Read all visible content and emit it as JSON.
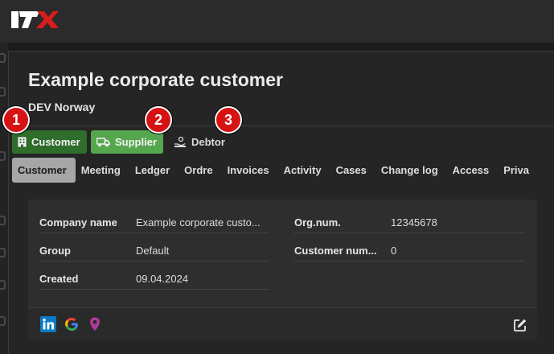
{
  "app": {
    "logo_text": "ITX"
  },
  "page": {
    "title": "Example corporate customer",
    "subtitle": "DEV Norway"
  },
  "roles": [
    {
      "label": "Customer",
      "icon": "building-icon"
    },
    {
      "label": "Supplier",
      "icon": "truck-icon"
    },
    {
      "label": "Debtor",
      "icon": "hand-coin-icon"
    }
  ],
  "badges": [
    "1",
    "2",
    "3"
  ],
  "tabs": [
    "Customer",
    "Meeting",
    "Ledger",
    "Ordre",
    "Invoices",
    "Activity",
    "Cases",
    "Change log",
    "Access",
    "Priva"
  ],
  "details": {
    "left": [
      {
        "label": "Company name",
        "value": "Example corporate custo..."
      },
      {
        "label": "Group",
        "value": "Default"
      },
      {
        "label": "Created",
        "value": "09.04.2024"
      }
    ],
    "right": [
      {
        "label": "Org.num.",
        "value": "12345678"
      },
      {
        "label": "Customer num...",
        "value": "0"
      }
    ]
  },
  "footer_icons": [
    "linkedin-icon",
    "google-icon",
    "map-pin-icon",
    "edit-icon"
  ],
  "colors": {
    "customer_active": "#2f6d2c",
    "supplier_active": "#55a74e",
    "badge": "#d61313",
    "tab_active": "#a6a6a6"
  }
}
